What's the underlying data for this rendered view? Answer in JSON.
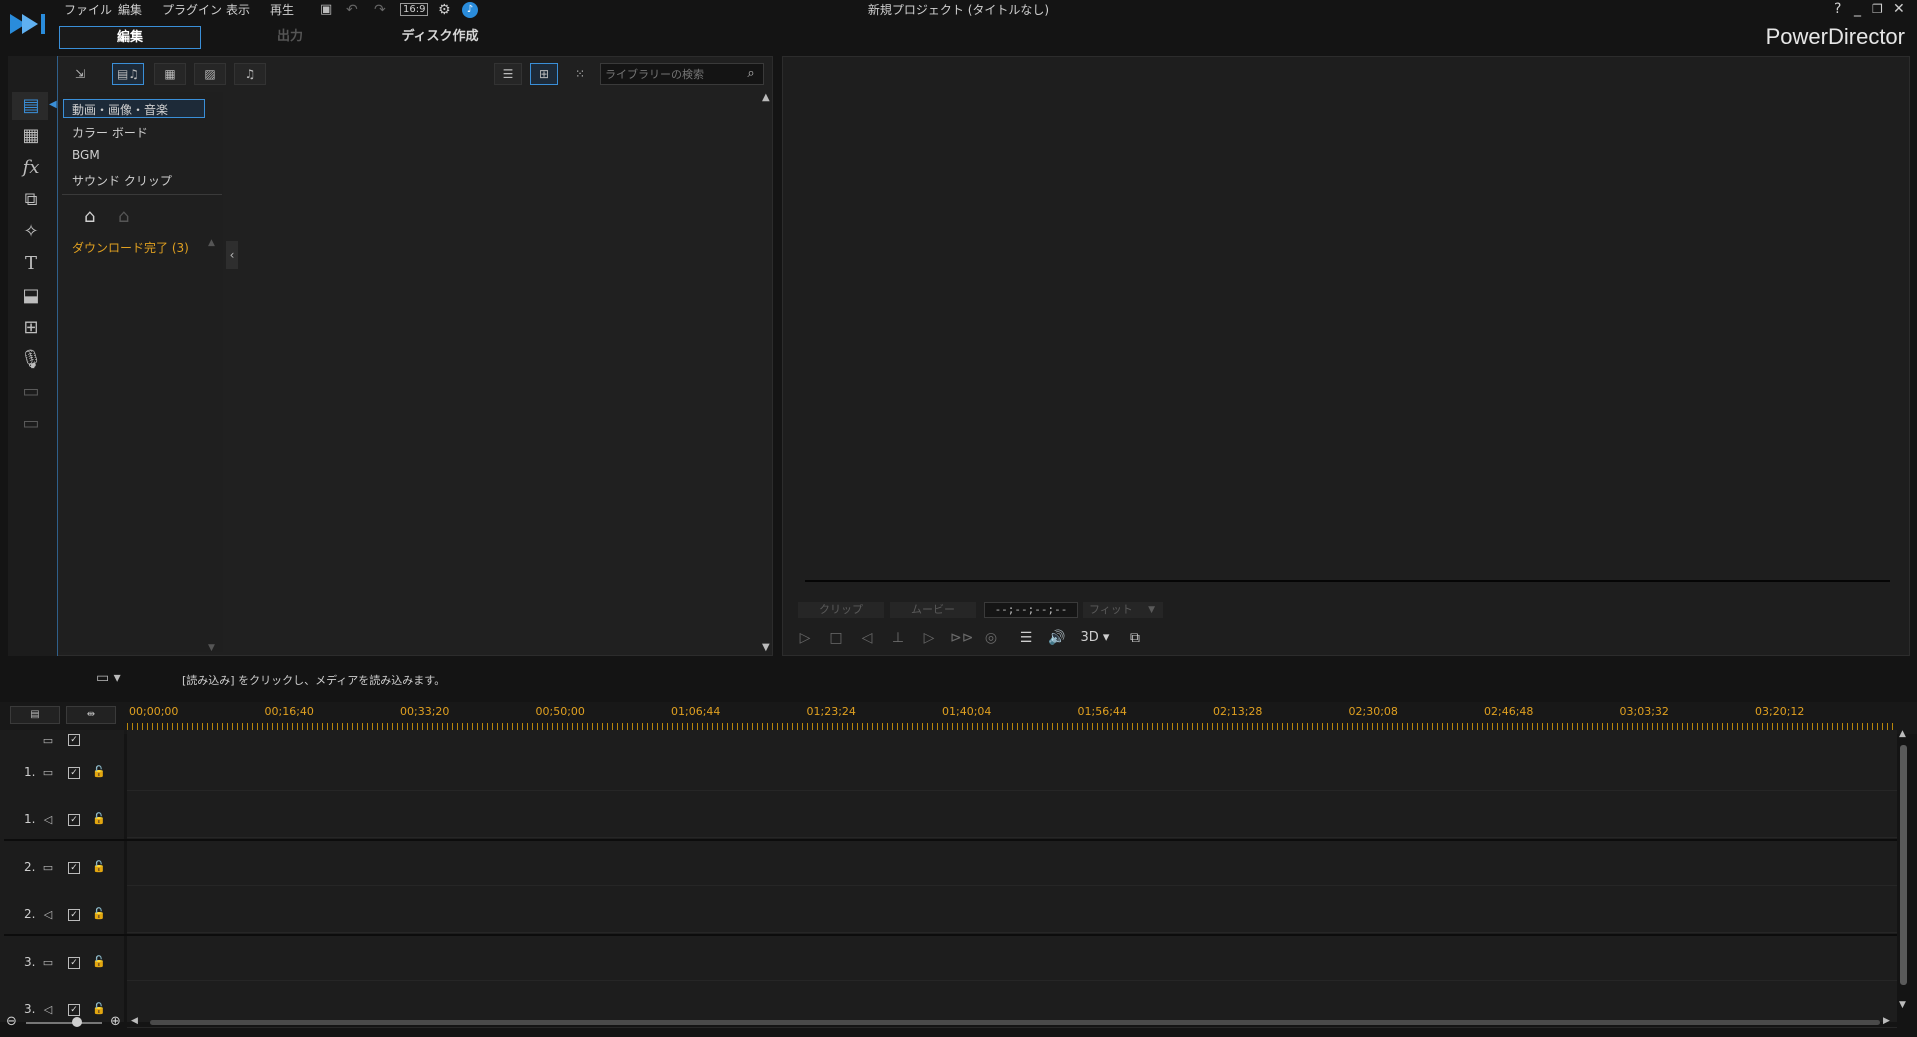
{
  "titlebar": {
    "menu": [
      "ファイル",
      "編集",
      "プラグイン",
      "表示",
      "再生"
    ],
    "aspect_ratio": "16:9",
    "window_title": "新規プロジェクト (タイトルなし)",
    "controls": [
      "?",
      "_",
      "❐",
      "✕"
    ]
  },
  "mode_tabs": {
    "edit": "編集",
    "output": "出力",
    "disc": "ディスク作成"
  },
  "brand": "PowerDirector",
  "library": {
    "tree": [
      "動画・画像・音楽",
      "カラー ボード",
      "BGM",
      "サウンド クリップ"
    ],
    "download_label": "ダウンロード完了 (3)",
    "search_placeholder": "ライブラリーの検索"
  },
  "preview": {
    "tab_clip": "クリップ",
    "tab_movie": "ムービー",
    "timecode": "--;--;--;--",
    "fit": "フィット",
    "mode_3d": "3D"
  },
  "status_text": "[読み込み] をクリックし、メディアを読み込みます。",
  "ruler_labels": [
    "00;00;00",
    "00;16;40",
    "00;33;20",
    "00;50;00",
    "01;06;44",
    "01;23;24",
    "01;40;04",
    "01;56;44",
    "02;13;28",
    "02;30;08",
    "02;46;48",
    "03;03;32",
    "03;20;12"
  ],
  "tracks": [
    {
      "num": "1.",
      "type": "video"
    },
    {
      "num": "1.",
      "type": "audio"
    },
    {
      "num": "2.",
      "type": "video"
    },
    {
      "num": "2.",
      "type": "audio"
    },
    {
      "num": "3.",
      "type": "video"
    },
    {
      "num": "3.",
      "type": "audio"
    }
  ],
  "colors": {
    "accent": "#3a8fd8",
    "ruler": "#e0a020",
    "background": "#141414"
  }
}
